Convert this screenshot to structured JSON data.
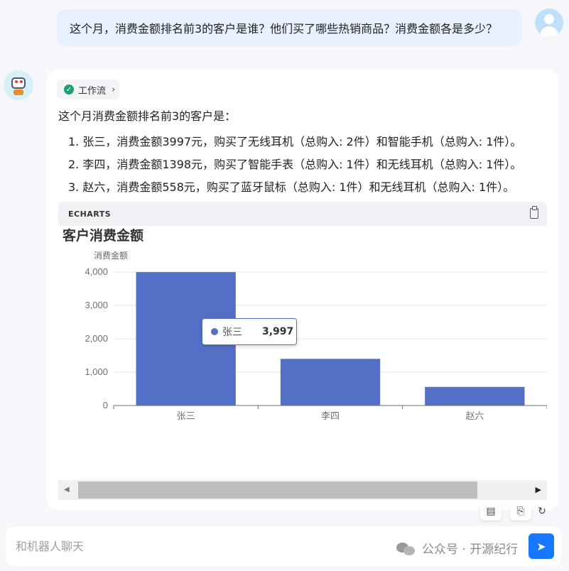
{
  "user_message": {
    "text": "这个月，消费金额排名前3的客户是谁？他们买了哪些热销商品？消费金额各是多少？"
  },
  "bot": {
    "workflow_label": "工作流",
    "intro": "这个月消费金额排名前3的客户是：",
    "items": [
      "1. 张三，消费金额3997元，购买了无线耳机（总购入: 2件）和智能手机（总购入: 1件）。",
      "2. 李四，消费金额1398元，购买了智能手表（总购入: 1件）和无线耳机（总购入: 1件）。",
      "3. 赵六，消费金额558元，购买了蓝牙鼠标（总购入: 1件）和无线耳机（总购入: 1件）。"
    ],
    "echarts_label": "ECHARTS"
  },
  "chart_data": {
    "type": "bar",
    "title": "客户消费金额",
    "ylabel": "消费金额",
    "xlabel": "",
    "categories": [
      "张三",
      "李四",
      "赵六"
    ],
    "values": [
      3997,
      1398,
      558
    ],
    "ylim": [
      0,
      4000
    ],
    "yticks": [
      "0",
      "1,000",
      "2,000",
      "3,000",
      "4,000"
    ],
    "bar_color": "#5470c6",
    "grid": true,
    "legend": "none",
    "tooltip": {
      "name": "张三",
      "value": "3,997"
    }
  },
  "input": {
    "placeholder": "和机器人聊天"
  },
  "watermark": "公众号 · 开源纪行",
  "colors": {
    "accent": "#1677ff",
    "user_bubble": "#e6f0ff",
    "success": "#1aa26a"
  }
}
